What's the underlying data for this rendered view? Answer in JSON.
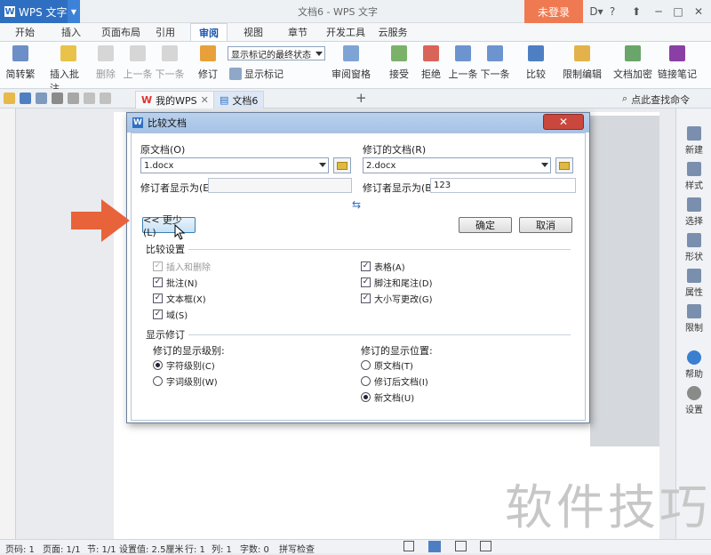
{
  "titlebar": {
    "app_name": "WPS 文字",
    "doc_title": "文档6 - WPS 文字",
    "login": "未登录",
    "help": "?"
  },
  "menu": {
    "items": [
      "开始",
      "插入",
      "页面布局",
      "引用",
      "审阅",
      "视图",
      "章节",
      "开发工具",
      "云服务"
    ],
    "active": "审阅"
  },
  "ribbon": {
    "fanzhuan": "简转繁",
    "insert_comment": "插入批注",
    "delete": "删除",
    "prev": "上一条",
    "next": "下一条",
    "revise": "修订",
    "markup_state": "显示标记的最终状态",
    "show_markup": "显示标记",
    "review_pane": "审阅窗格",
    "accept": "接受",
    "reject": "拒绝",
    "prev2": "上一条",
    "next2": "下一条",
    "compare": "比较",
    "restrict_edit": "限制编辑",
    "doc_encrypt": "文档加密",
    "link_note": "链接笔记"
  },
  "tabs": {
    "mywps": "我的WPS",
    "doc6": "文档6",
    "search": "点此查找命令"
  },
  "dialog": {
    "title": "比较文档",
    "orig_label": "原文档(O)",
    "orig_value": "1.docx",
    "rev_label": "修订的文档(R)",
    "rev_value": "2.docx",
    "author_label_left": "修订者显示为(E)",
    "author_value_left": "",
    "author_label_right": "修订者显示为(B)",
    "author_value_right": "123",
    "less_button": "<< 更少(L)",
    "ok": "确定",
    "cancel": "取消",
    "compare_settings": "比较设置",
    "options_left": [
      {
        "label": "插入和删除",
        "checked": true,
        "disabled": true
      },
      {
        "label": "批注(N)",
        "checked": true,
        "disabled": false
      },
      {
        "label": "文本框(X)",
        "checked": true,
        "disabled": false
      },
      {
        "label": "域(S)",
        "checked": true,
        "disabled": false
      }
    ],
    "options_right": [
      {
        "label": "表格(A)",
        "checked": true,
        "disabled": false
      },
      {
        "label": "脚注和尾注(D)",
        "checked": true,
        "disabled": false
      },
      {
        "label": "大小写更改(G)",
        "checked": true,
        "disabled": false
      }
    ],
    "show_revisions": "显示修订",
    "level_label": "修订的显示级别:",
    "levels": [
      {
        "label": "字符级别(C)",
        "selected": true
      },
      {
        "label": "字词级别(W)",
        "selected": false
      }
    ],
    "position_label": "修订的显示位置:",
    "positions": [
      {
        "label": "原文档(T)",
        "selected": false
      },
      {
        "label": "修订后文档(I)",
        "selected": false
      },
      {
        "label": "新文档(U)",
        "selected": true
      }
    ]
  },
  "sidepanel": [
    "新建",
    "样式",
    "选择",
    "形状",
    "属性",
    "限制",
    "帮助",
    "设置"
  ],
  "status": {
    "page_code": "页码: 1",
    "pages": "页面: 1/1",
    "section": "节: 1/1",
    "setting": "设置值: 2.5厘米",
    "row": "行: 1",
    "col": "列: 1",
    "words": "字数: 0",
    "spell": "拼写检查"
  },
  "watermark": "软件技巧",
  "colors": {
    "accent": "#2f6fc2",
    "login": "#ef7a52",
    "arrow": "#e8623a"
  }
}
